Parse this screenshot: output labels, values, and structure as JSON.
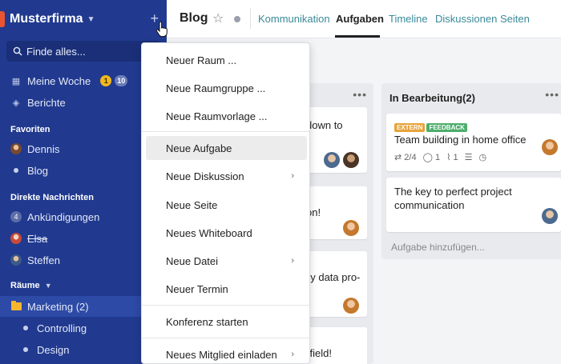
{
  "sidebar": {
    "brand": "Musterfirma",
    "search_placeholder": "Finde alles...",
    "my_week": "Meine Woche",
    "my_week_badge_yellow": "1",
    "my_week_badge_gray": "10",
    "reports": "Berichte",
    "favorites_heading": "Favoriten",
    "fav_dennis": "Dennis",
    "fav_blog": "Blog",
    "direct_heading": "Direkte Nachrichten",
    "dm_announcements_count": "4",
    "dm_announcements": "Ankündigungen",
    "dm_elsa": "Elsa",
    "dm_steffen": "Steffen",
    "rooms_heading": "Räume",
    "room_marketing": "Marketing (2)",
    "room_controlling": "Controlling",
    "room_design": "Design"
  },
  "header": {
    "title": "Blog",
    "tabs": [
      "Kommunikation",
      "Aufgaben",
      "Timeline",
      "Diskussionen",
      "Seiten"
    ],
    "active_tab": "Aufgaben"
  },
  "board": {
    "col1_fragments": [
      "down to",
      "on!",
      "ey data pro-",
      "kfield!"
    ],
    "col2_title": "In Bearbeitung(2)",
    "card1_tags": [
      "EXTERN",
      "FEEDBACK"
    ],
    "card1_tag_colors": [
      "#e8a33a",
      "#4cae6b"
    ],
    "card1_text": "Team building in home office",
    "card1_meta": [
      "2/4",
      "1",
      "1"
    ],
    "card2_text": "The key to perfect project communication",
    "add_task": "Aufgabe hinzufügen..."
  },
  "menu": {
    "items": [
      "Neuer Raum ...",
      "Neue Raumgruppe ...",
      "Neue Raumvorlage ...",
      "Neue Aufgabe",
      "Neue Diskussion",
      "Neue Seite",
      "Neues Whiteboard",
      "Neue Datei",
      "Neuer Termin",
      "Konferenz starten",
      "Neues Mitglied einladen"
    ],
    "highlighted": "Neue Aufgabe"
  },
  "colors": {
    "sidebar_bg": "#213a8f",
    "accent_tab": "#3a8a9a",
    "brand_mark": "#e8542f"
  }
}
